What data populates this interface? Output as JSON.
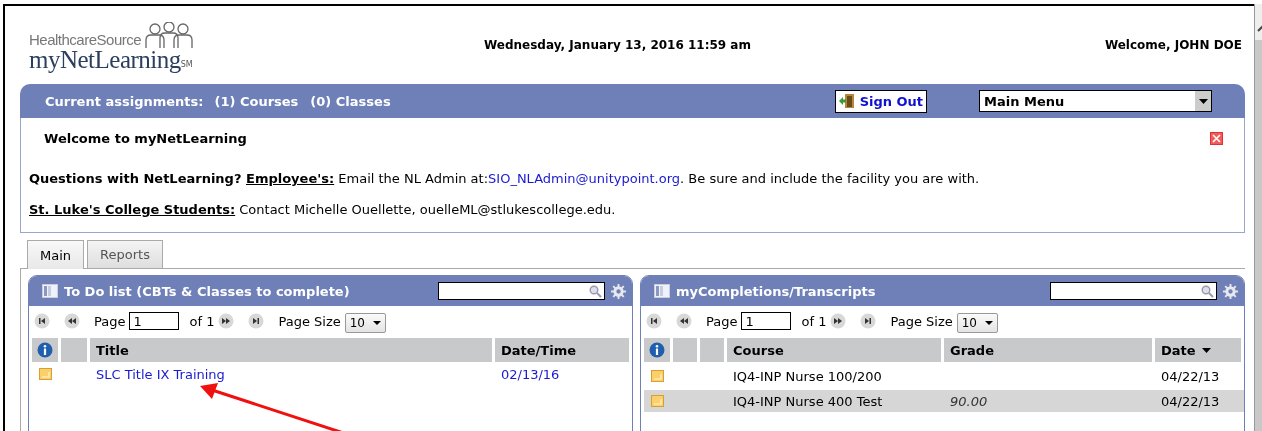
{
  "header": {
    "logo_top": "HealthcareSource",
    "logo_main": "myNetLearning",
    "logo_mark": "SM",
    "datetime": "Wednesday, January 13, 2016 11:59 am",
    "welcome": "Welcome, JOHN DOE"
  },
  "assignment_bar": {
    "label": "Current assignments:",
    "courses": "(1) Courses",
    "classes": "(0) Classes",
    "sign_out": "Sign Out",
    "menu": {
      "value": "Main Menu"
    }
  },
  "notice": {
    "title": "Welcome to myNetLearning",
    "lines": [
      {
        "heading": "Questions with NetLearning?",
        "label": "Employee's:",
        "text_before": "Email the NL Admin at:",
        "link": "SIO_NLAdmin@unitypoint.org",
        "text_after": ". Be sure and include the facility you are with."
      },
      {
        "label": "St. Luke's College Students:",
        "text_before": "Contact Michelle Ouellette, ouelleML@stlukescollege.edu."
      }
    ]
  },
  "tabs": [
    {
      "label": "Main",
      "selected": true
    },
    {
      "label": "Reports",
      "selected": false
    }
  ],
  "todo": {
    "title": "To Do list (CBTs & Classes to complete)",
    "pager": {
      "page_label": "Page",
      "page": "1",
      "of": "of 1",
      "size_label": "Page Size",
      "size": "10"
    },
    "columns": [
      {
        "label": "Title"
      },
      {
        "label": "Date/Time"
      }
    ],
    "rows": [
      {
        "title": "SLC Title IX Training",
        "date": "02/13/16"
      }
    ]
  },
  "completions": {
    "title": "myCompletions/Transcripts",
    "pager": {
      "page_label": "Page",
      "page": "1",
      "of": "of 1",
      "size_label": "Page Size",
      "size": "10"
    },
    "columns": [
      {
        "label": "Course",
        "sorted": false
      },
      {
        "label": "Grade",
        "sorted": false
      },
      {
        "label": "Date",
        "sorted": true
      }
    ],
    "rows": [
      {
        "course": "IQ4-INP Nurse 100/200",
        "date": "04/22/13",
        "selected": false
      },
      {
        "course": "IQ4-INP Nurse 400 Test",
        "grade": "90.00",
        "date": "04/22/13",
        "selected": true
      }
    ]
  }
}
